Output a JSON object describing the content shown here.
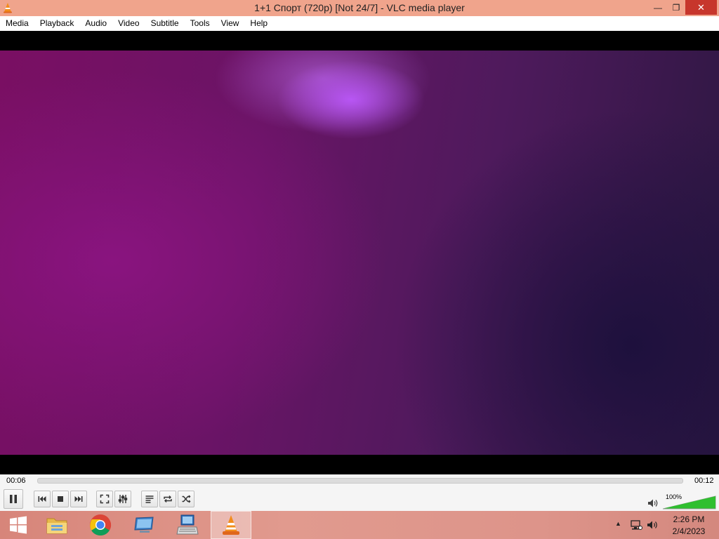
{
  "window": {
    "title": "1+1 Спорт (720p) [Not 24/7] - VLC media player",
    "minimize_symbol": "—",
    "maximize_symbol": "❐",
    "close_symbol": "✕"
  },
  "menu": [
    "Media",
    "Playback",
    "Audio",
    "Video",
    "Subtitle",
    "Tools",
    "View",
    "Help"
  ],
  "player": {
    "elapsed": "00:06",
    "total": "00:12",
    "progress": 0.0,
    "volume_label": "100%",
    "volume": 1.0,
    "state": "playing"
  },
  "controls": [
    "pause-icon",
    "previous-icon",
    "stop-icon",
    "next-icon",
    "fullscreen-icon",
    "extended-settings-icon",
    "playlist-icon",
    "loop-icon",
    "shuffle-icon"
  ],
  "taskbar": {
    "apps": [
      "windows-start-icon",
      "file-explorer-icon",
      "chrome-icon",
      "remote-desktop-icon",
      "on-screen-keyboard-icon",
      "vlc-icon"
    ],
    "active_app": "vlc-icon",
    "clock_time": "2:26 PM",
    "clock_date": "2/4/2023",
    "tray_arrow": "▲"
  },
  "colors": {
    "titlebar": "#f0a48c",
    "close_button": "#c7362c",
    "volume_fill": "#2fbf2f"
  }
}
